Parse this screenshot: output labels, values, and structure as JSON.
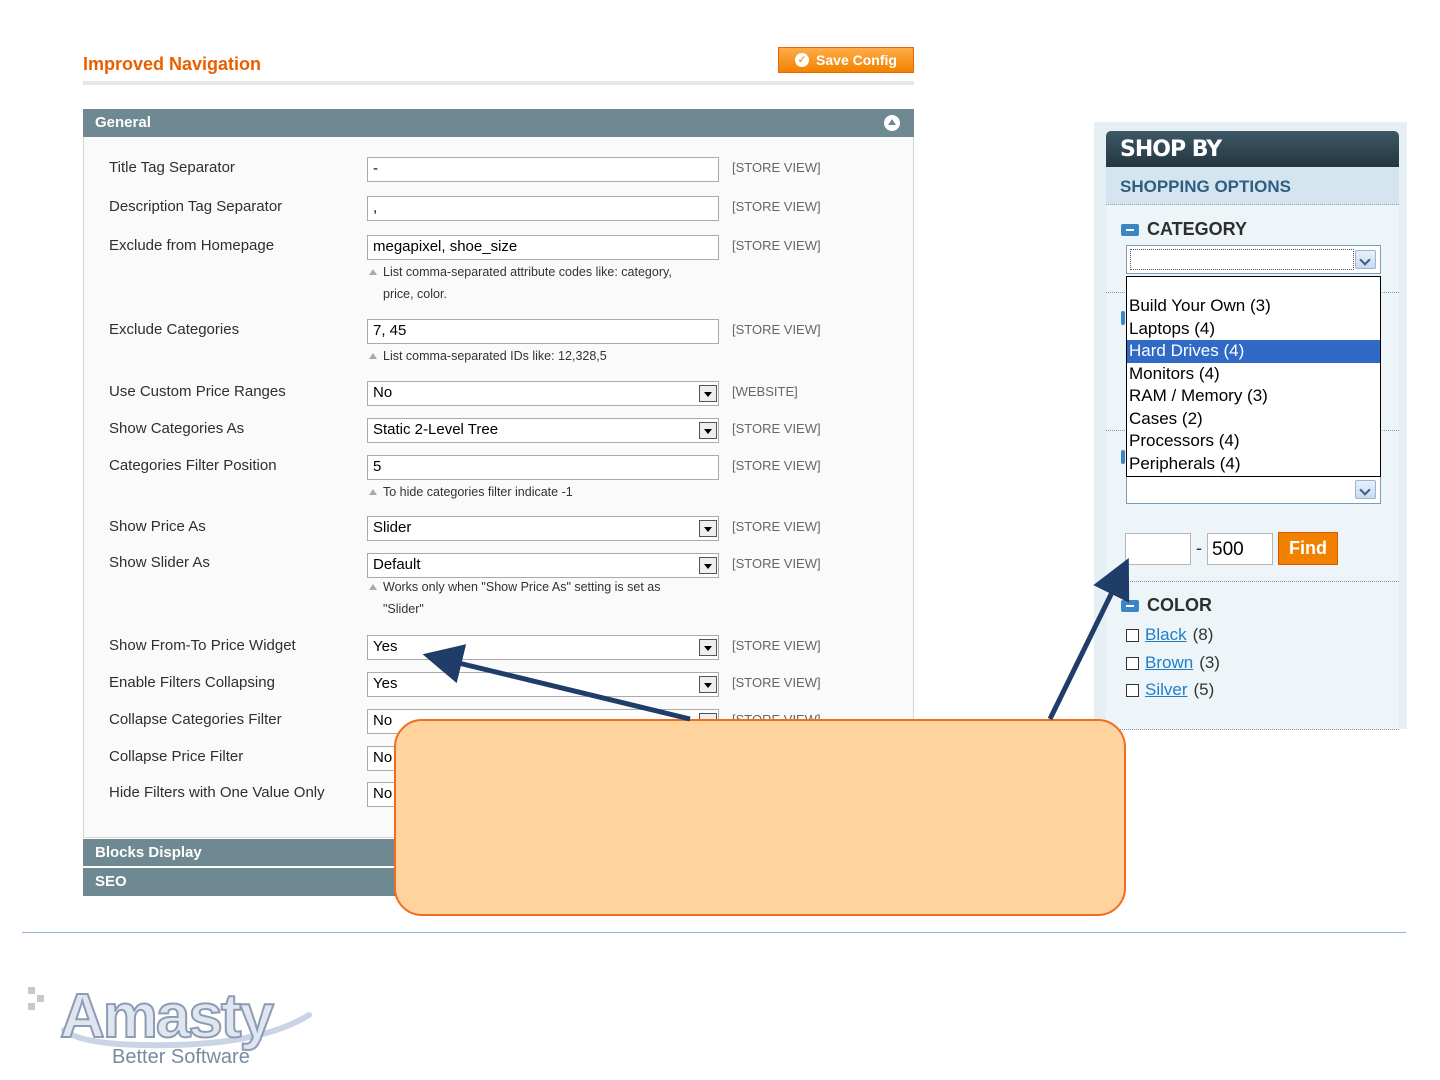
{
  "header": {
    "title": "Improved Navigation",
    "save_label": "Save Config"
  },
  "sections": {
    "general": "General",
    "blocks_display": "Blocks Display",
    "seo": "SEO"
  },
  "rows": [
    {
      "label": "Title Tag Separator",
      "value": "-",
      "scope": "[STORE VIEW]",
      "type": "text"
    },
    {
      "label": "Description Tag Separator",
      "value": ",",
      "scope": "[STORE VIEW]",
      "type": "text"
    },
    {
      "label": "Exclude from Homepage",
      "value": "megapixel, shoe_size",
      "scope": "[STORE VIEW]",
      "type": "text",
      "note": [
        "List comma-separated attribute codes like: category,",
        "price, color."
      ]
    },
    {
      "label": "Exclude Categories",
      "value": "7, 45",
      "scope": "[STORE VIEW]",
      "type": "text",
      "note": [
        "List comma-separated IDs like: 12,328,5"
      ]
    },
    {
      "label": "Use Custom Price Ranges",
      "value": "No",
      "scope": "[WEBSITE]",
      "type": "select"
    },
    {
      "label": "Show Categories As",
      "value": "Static 2-Level Tree",
      "scope": "[STORE VIEW]",
      "type": "select"
    },
    {
      "label": "Categories Filter Position",
      "value": "5",
      "scope": "[STORE VIEW]",
      "type": "text",
      "note": [
        "To hide categories filter indicate -1"
      ]
    },
    {
      "label": "Show Price As",
      "value": "Slider",
      "scope": "[STORE VIEW]",
      "type": "select"
    },
    {
      "label": "Show Slider As",
      "value": "Default",
      "scope": "[STORE VIEW]",
      "type": "select",
      "note": [
        "Works only when \"Show Price As\" setting is set as",
        "\"Slider\""
      ]
    },
    {
      "label": "Show From-To Price Widget",
      "value": "Yes",
      "scope": "[STORE VIEW]",
      "type": "select"
    },
    {
      "label": "Enable Filters Collapsing",
      "value": "Yes",
      "scope": "[STORE VIEW]",
      "type": "select"
    },
    {
      "label": "Collapse Categories Filter",
      "value": "No",
      "scope": "[STORE VIEW]",
      "type": "select"
    },
    {
      "label": "Collapse Price Filter",
      "value": "No",
      "scope": "",
      "type": "select"
    },
    {
      "label": "Hide Filters with One Value Only",
      "value": "No",
      "scope": "",
      "type": "select"
    }
  ],
  "shop": {
    "heading": "SHOP BY",
    "options_heading": "SHOPPING OPTIONS",
    "category_title": "CATEGORY",
    "category_options": [
      "Build Your Own (3)",
      "Laptops (4)",
      "Hard Drives (4)",
      "Monitors (4)",
      "RAM / Memory (3)",
      "Cases (2)",
      "Processors (4)",
      "Peripherals (4)"
    ],
    "category_highlighted": "Hard Drives (4)",
    "price_separator": "-",
    "price_to": "500",
    "find_label": "Find",
    "color_title": "COLOR",
    "colors": [
      {
        "name": "Black",
        "count": "(8)"
      },
      {
        "name": "Brown",
        "count": "(3)"
      },
      {
        "name": "Silver",
        "count": "(5)"
      }
    ]
  },
  "footer": {
    "logo_text": "Amasty",
    "tagline": "Better Software"
  },
  "colors": {
    "accent": "#eb5e00",
    "section_header": "#6f8992",
    "callout_fill": "#ffd39e",
    "callout_border": "#ef6e1f",
    "arrow": "#1f3d68",
    "highlight": "#3169c6"
  }
}
